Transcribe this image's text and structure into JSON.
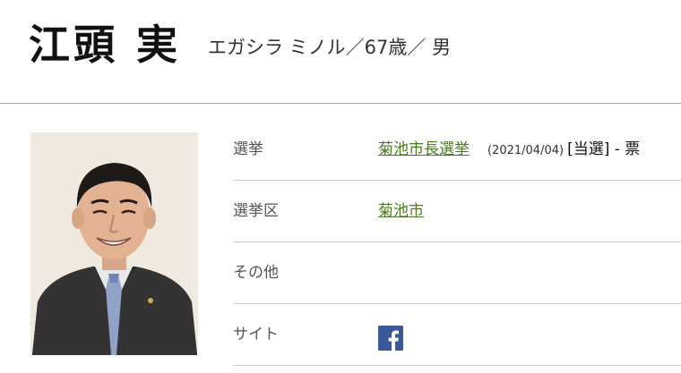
{
  "profile": {
    "name": "江頭 実",
    "reading_age_gender": "エガシラ ミノル／67歳／ 男"
  },
  "details": {
    "election_label": "選挙",
    "election_link": "菊池市長選挙",
    "election_date": "(2021/04/04)",
    "election_result": "[当選] - 票",
    "district_label": "選挙区",
    "district_link": "菊池市",
    "other_label": "その他",
    "other_value": "",
    "site_label": "サイト"
  },
  "icons": {
    "site": "facebook-icon"
  },
  "colors": {
    "link": "#4a7a1f",
    "divider": "#9ebf74",
    "facebook": "#3b5998"
  }
}
